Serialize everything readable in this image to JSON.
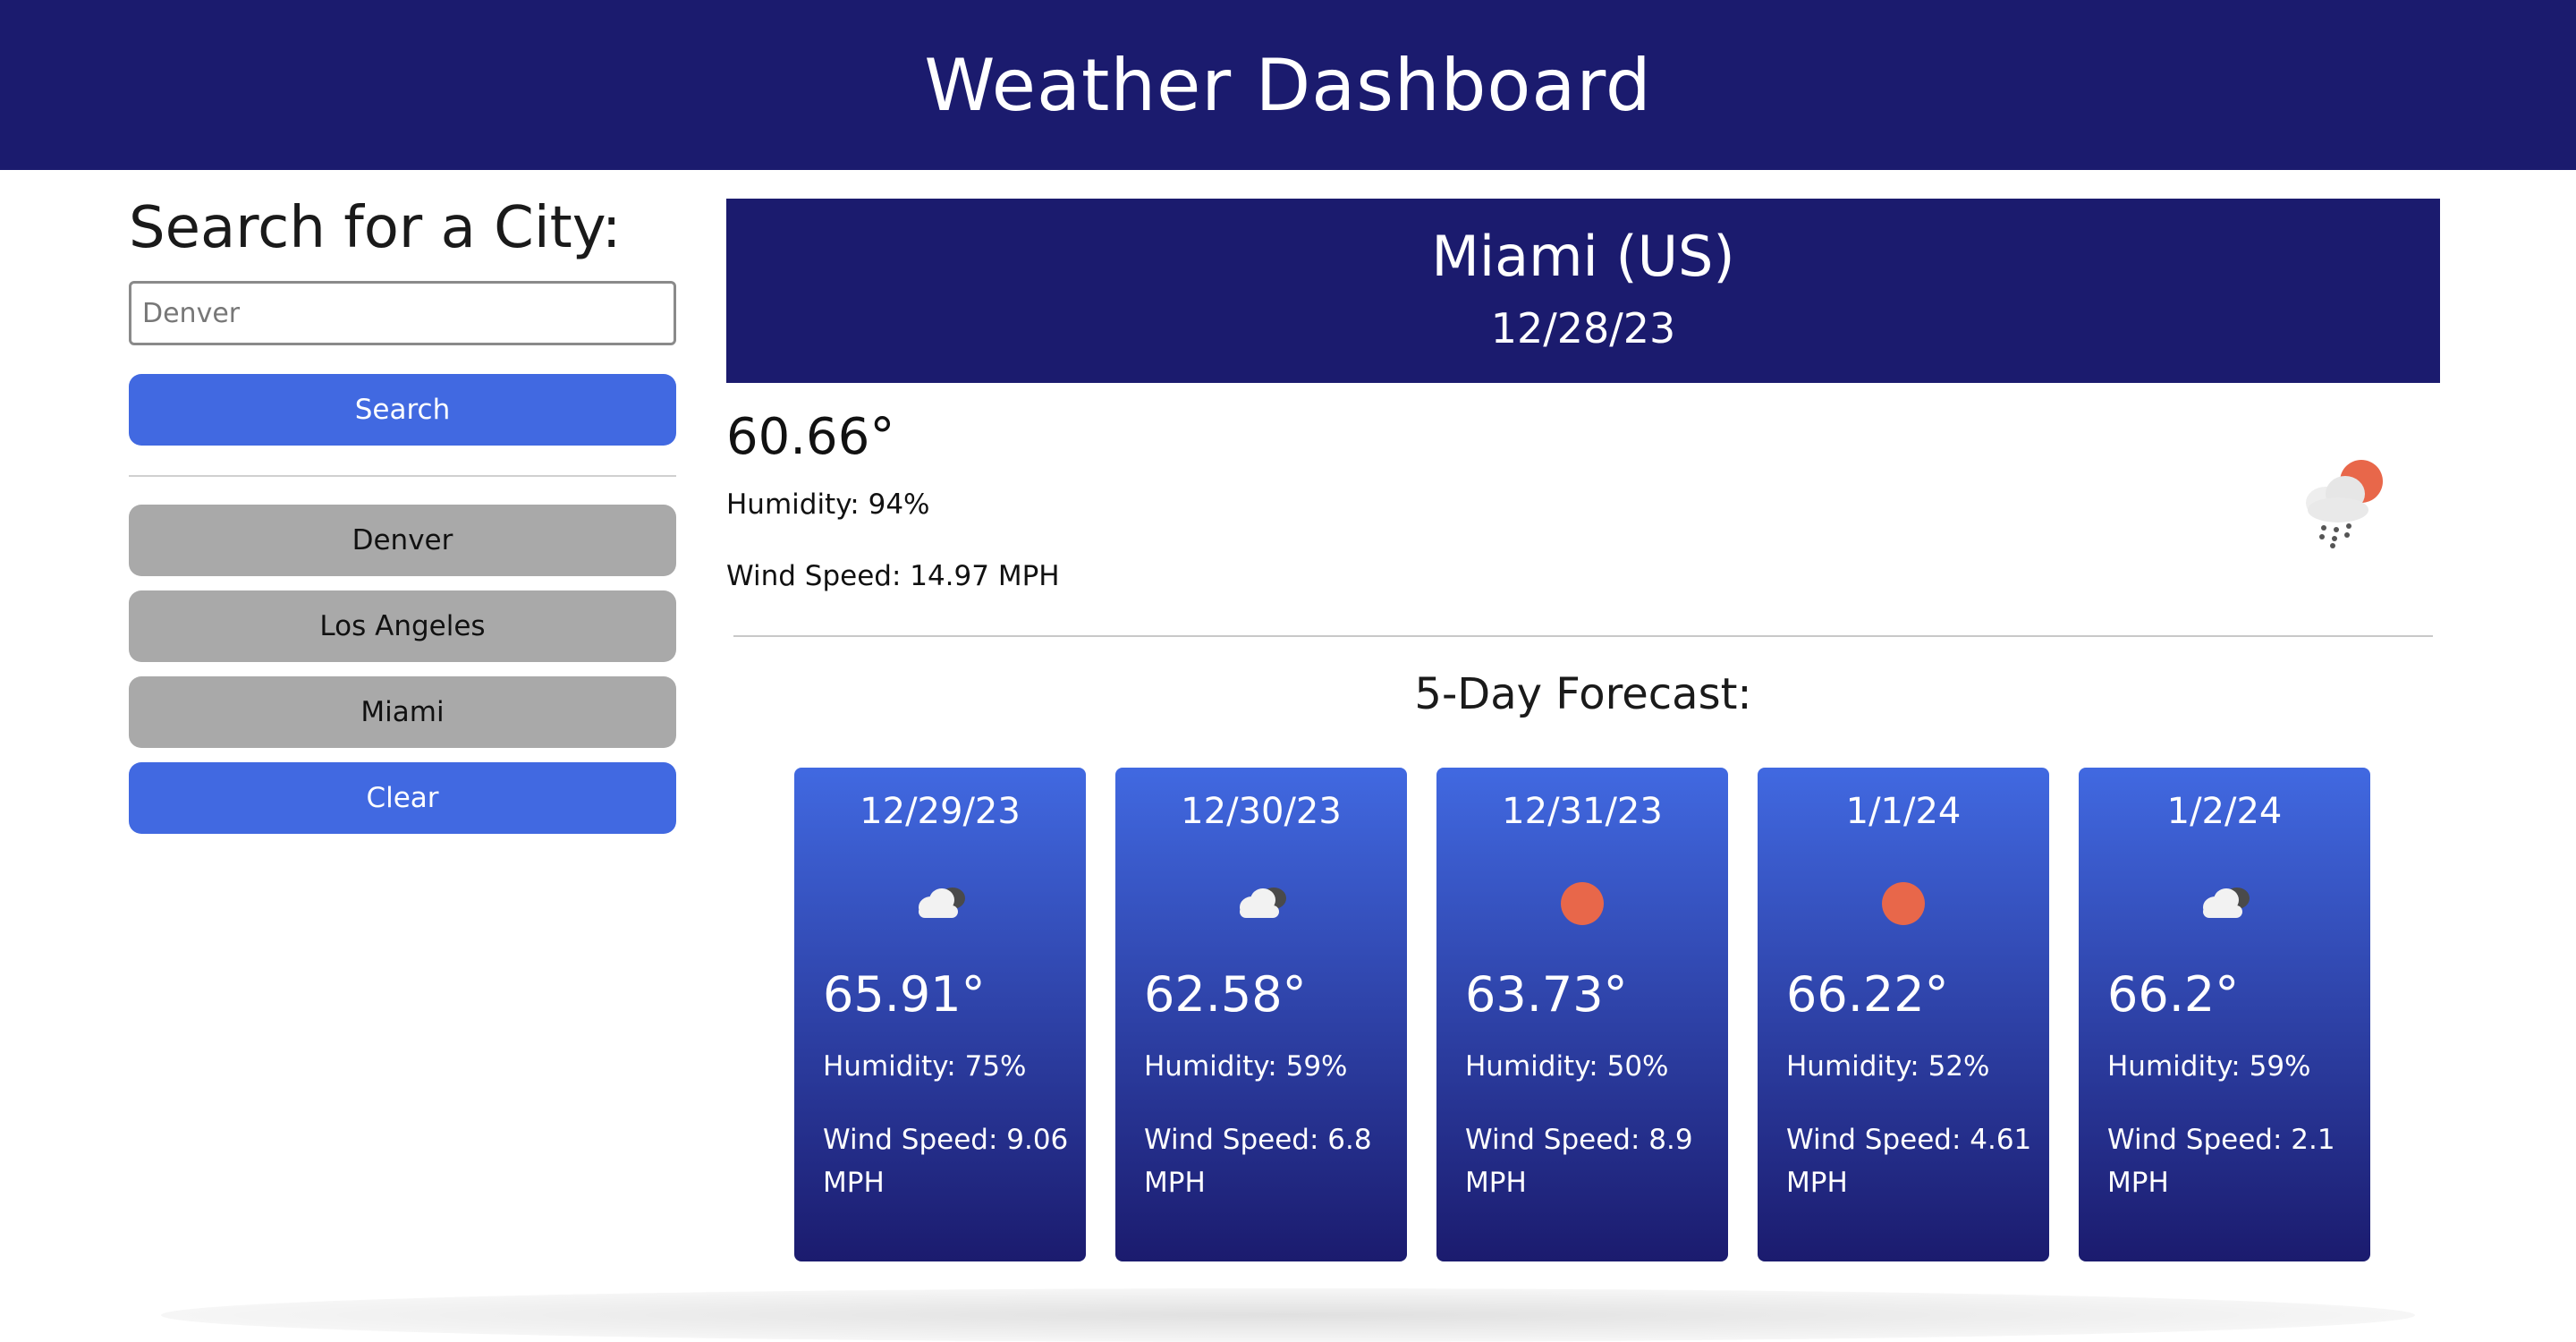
{
  "header": {
    "title": "Weather Dashboard"
  },
  "sidebar": {
    "search_title": "Search for a City:",
    "search_placeholder": "Denver",
    "search_button": "Search",
    "history": [
      {
        "label": "Denver"
      },
      {
        "label": "Los Angeles"
      },
      {
        "label": "Miami"
      }
    ],
    "clear_button": "Clear"
  },
  "current": {
    "city": "Miami (US)",
    "date": "12/28/23",
    "temp": "60.66°",
    "humidity": "Humidity: 94%",
    "wind": "Wind Speed: 14.97 MPH",
    "icon": "rain-cloud-sun-icon"
  },
  "forecast": {
    "title": "5-Day Forecast:",
    "days": [
      {
        "date": "12/29/23",
        "icon": "cloud-icon",
        "temp": "65.91°",
        "humidity": "Humidity: 75%",
        "wind": "Wind Speed: 9.06 MPH"
      },
      {
        "date": "12/30/23",
        "icon": "cloud-icon",
        "temp": "62.58°",
        "humidity": "Humidity: 59%",
        "wind": "Wind Speed: 6.8 MPH"
      },
      {
        "date": "12/31/23",
        "icon": "sun-icon",
        "temp": "63.73°",
        "humidity": "Humidity: 50%",
        "wind": "Wind Speed: 8.9 MPH"
      },
      {
        "date": "1/1/24",
        "icon": "sun-icon",
        "temp": "66.22°",
        "humidity": "Humidity: 52%",
        "wind": "Wind Speed: 4.61 MPH"
      },
      {
        "date": "1/2/24",
        "icon": "cloud-icon",
        "temp": "66.2°",
        "humidity": "Humidity: 59%",
        "wind": "Wind Speed: 2.1 MPH"
      }
    ]
  },
  "colors": {
    "navy": "#1b1b6e",
    "accent_blue": "#4169e1",
    "history_gray": "#a9a9a9",
    "sun_orange": "#e8674a"
  }
}
